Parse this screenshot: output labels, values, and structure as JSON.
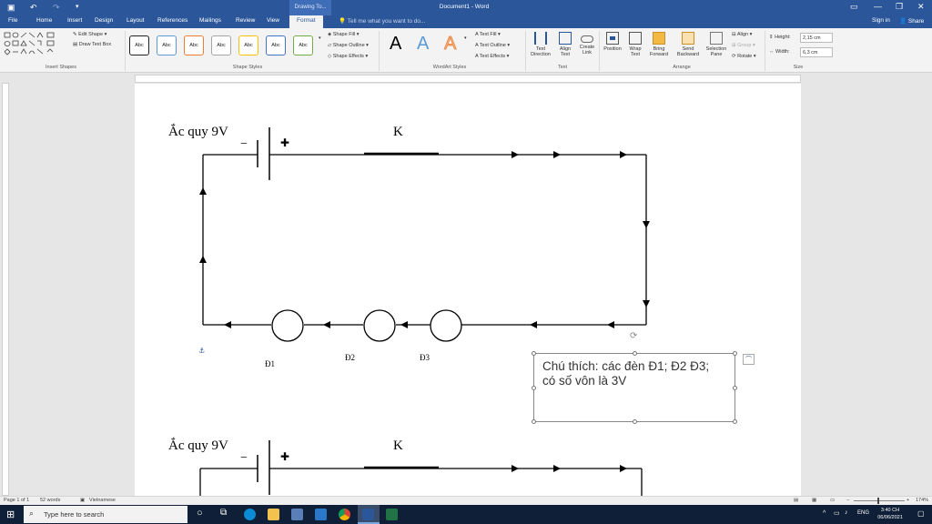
{
  "titlebar": {
    "context_tab": "Drawing To...",
    "title": "Document1 - Word"
  },
  "tabs": [
    {
      "label": "File",
      "active": false
    },
    {
      "label": "Home",
      "active": false
    },
    {
      "label": "Insert",
      "active": false
    },
    {
      "label": "Design",
      "active": false
    },
    {
      "label": "Layout",
      "active": false
    },
    {
      "label": "References",
      "active": false
    },
    {
      "label": "Mailings",
      "active": false
    },
    {
      "label": "Review",
      "active": false
    },
    {
      "label": "View",
      "active": false
    },
    {
      "label": "Format",
      "active": true
    }
  ],
  "tell_me": "Tell me what you want to do...",
  "sign_in": "Sign in",
  "share": "Share",
  "ribbon": {
    "insert_shapes": {
      "edit_shape": "Edit Shape",
      "draw_text_box": "Draw Text Box",
      "label": "Insert Shapes"
    },
    "shape_styles": {
      "swatch_label": "Abc",
      "fill": "Shape Fill",
      "outline": "Shape Outline",
      "effects": "Shape Effects",
      "label": "Shape Styles"
    },
    "wordart": {
      "letter": "A",
      "text_fill": "Text Fill",
      "text_outline": "Text Outline",
      "text_effects": "Text Effects",
      "label": "WordArt Styles"
    },
    "text": {
      "direction": "Text Direction",
      "align": "Align Text",
      "link": "Create Link",
      "label": "Text"
    },
    "arrange": {
      "position": "Position",
      "wrap": "Wrap Text",
      "forward": "Bring Forward",
      "backward": "Send Backward",
      "selection": "Selection Pane",
      "align": "Align",
      "group": "Group",
      "rotate": "Rotate",
      "label": "Arrange"
    },
    "size": {
      "height_label": "Height:",
      "height_value": "2,15 cm",
      "width_label": "Width:",
      "width_value": "6,3 cm",
      "label": "Size"
    }
  },
  "document": {
    "heading_battery": "Ắc quy 9V",
    "switch_label": "K",
    "minus": "−",
    "plus": "✚",
    "lamps": [
      "Đ1",
      "Đ2",
      "Đ3"
    ],
    "caption": "Chú thích: các đèn Đ1; Đ2 Đ3; có số vôn là 3V"
  },
  "statusbar": {
    "page": "Page 1 of 1",
    "words": "52 words",
    "language": "Vietnamese",
    "zoom": "174%"
  },
  "taskbar": {
    "search": "Type here to search",
    "lang": "ENG",
    "time": "3:40 CH",
    "date": "06/06/2021"
  },
  "colors": {
    "word_blue": "#2b579a",
    "taskbar": "#0f1f37"
  }
}
